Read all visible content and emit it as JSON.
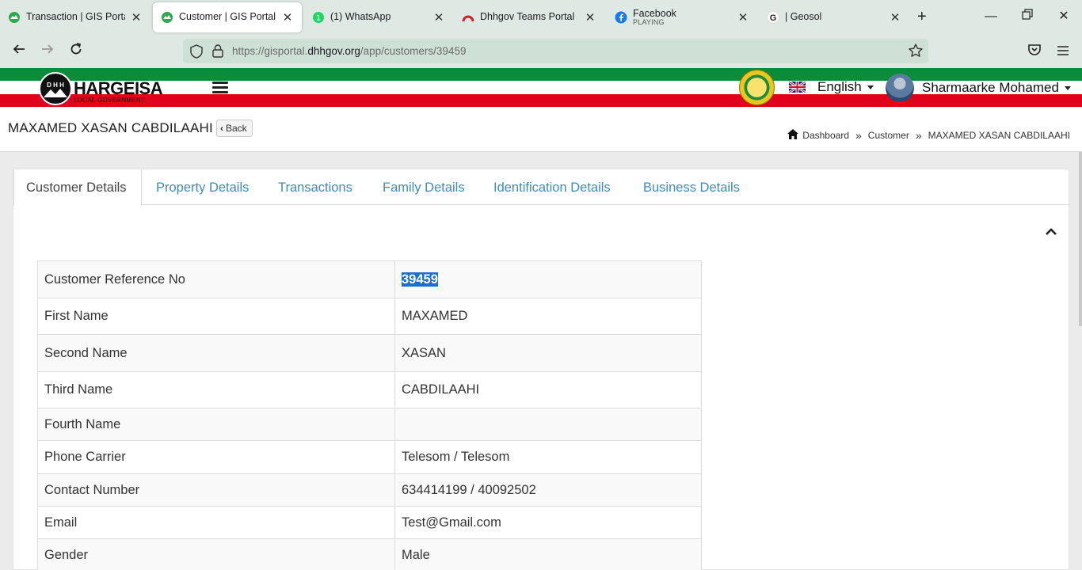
{
  "browser": {
    "tabs": [
      {
        "title": "Transaction | GIS Portal",
        "subtitle": "",
        "icon": "gis-portal-icon",
        "active": false
      },
      {
        "title": "Customer | GIS Portal",
        "subtitle": "",
        "icon": "gis-portal-icon",
        "active": true
      },
      {
        "title": "(1) WhatsApp",
        "subtitle": "",
        "icon": "whatsapp-icon",
        "active": false
      },
      {
        "title": "Dhhgov Teams Portal",
        "subtitle": "",
        "icon": "teams-portal-icon",
        "active": false
      },
      {
        "title": "Facebook",
        "subtitle": "PLAYING",
        "icon": "facebook-icon",
        "active": false
      },
      {
        "title": "| Geosol",
        "subtitle": "",
        "icon": "google-icon",
        "active": false
      }
    ],
    "url_prefix": "https://gisportal.",
    "url_domain": "dhhgov.org",
    "url_path": "/app/customers/39459"
  },
  "header": {
    "logo_text": "HARGEISA",
    "logo_subtext": "LOCAL GOVERNMENT",
    "logo_badge": "D H H",
    "language": "English",
    "user_name": "Sharmaarke Mohamed"
  },
  "page": {
    "title": "MAXAMED XASAN CABDILAAHI",
    "back_label": "Back",
    "breadcrumb": [
      "Dashboard",
      "Customer",
      "MAXAMED XASAN CABDILAAHI"
    ]
  },
  "tabs": [
    "Customer Details",
    "Property Details",
    "Transactions",
    "Family Details",
    "Identification Details",
    "Business Details"
  ],
  "details": [
    {
      "label": "Customer Reference No",
      "value": "39459",
      "selected": true
    },
    {
      "label": "First Name",
      "value": "MAXAMED"
    },
    {
      "label": "Second Name",
      "value": "XASAN"
    },
    {
      "label": "Third Name",
      "value": "CABDILAAHI"
    },
    {
      "label": "Fourth Name",
      "value": ""
    },
    {
      "label": "Phone Carrier",
      "value": "Telesom / Telesom"
    },
    {
      "label": "Contact Number",
      "value": "634414199 / 40092502"
    },
    {
      "label": "Email",
      "value": "Test@Gmail.com"
    },
    {
      "label": "Gender",
      "value": "Male"
    }
  ],
  "colors": {
    "link": "#3c8dbc",
    "flag_green": "#0b8c3a",
    "flag_red": "#e2001b",
    "selection": "#1a6fd1",
    "browser_chrome": "#dfe9e3"
  }
}
